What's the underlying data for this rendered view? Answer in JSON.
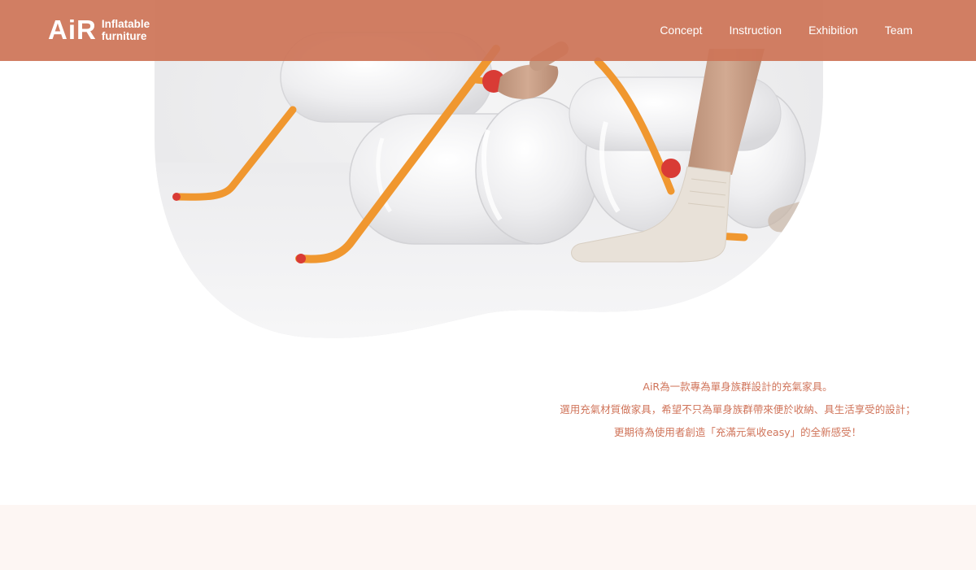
{
  "header": {
    "logo_mark": "AiR",
    "logo_sub_line1": "Inflatable",
    "logo_sub_line2": "furniture",
    "nav": [
      "Concept",
      "Instruction",
      "Exhibition",
      "Team"
    ]
  },
  "intro": {
    "lines": [
      "AiR為一款專為單身族群設計的充氣家具。",
      "選用充氣材質做家具，希望不只為單身族群帶來便於收納、具生活享受的設計；",
      "更期待為使用者創造「充滿元氣收easy」的全新感受！"
    ]
  },
  "colors": {
    "brand": "#cd7457",
    "text_accent": "#d0745a",
    "band": "#fdf6f3",
    "frame_orange": "#f0972f",
    "tip_red": "#d93b35"
  },
  "hero": {
    "image": "inflatable-chair-photo"
  }
}
